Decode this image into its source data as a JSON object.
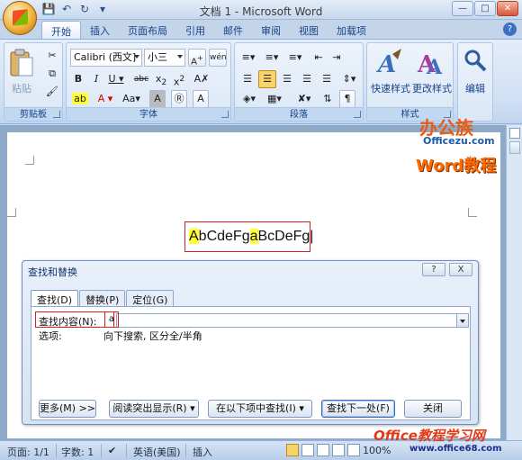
{
  "window": {
    "title": "文档 1 - Microsoft Word",
    "controls": [
      "minimize",
      "maximize",
      "close"
    ]
  },
  "ribbon_tabs": [
    "开始",
    "插入",
    "页面布局",
    "引用",
    "邮件",
    "审阅",
    "视图",
    "加载项"
  ],
  "ribbon": {
    "clipboard": {
      "label": "剪贴板",
      "paste": "粘贴"
    },
    "font": {
      "label": "字体",
      "font_name": "Calibri (西文]",
      "font_size": "小三",
      "wen": "wén"
    },
    "paragraph": {
      "label": "段落"
    },
    "styles": {
      "label": "样式",
      "quick_styles": "快速样式",
      "change_styles": "更改样式"
    },
    "editing": {
      "label": "编辑"
    }
  },
  "document": {
    "sample_text": "AbCdeFgaBcDeFg",
    "highlighted_chars": [
      "A",
      "a"
    ]
  },
  "dialog": {
    "title": "查找和替换",
    "tabs": [
      "查找(D)",
      "替换(P)",
      "定位(G)"
    ],
    "find_label": "查找内容(N):",
    "find_value": "a",
    "options_label": "选项:",
    "options_value": "向下搜索, 区分全/半角",
    "buttons": {
      "more": "更多(M) >>",
      "reading_highlight": "阅读突出显示(R)",
      "find_in": "在以下项中查找(I)",
      "find_next": "查找下一处(F)",
      "close": "关闭"
    },
    "title_buttons": [
      "?",
      "X"
    ]
  },
  "statusbar": {
    "page": "页面: 1/1",
    "words": "字数: 1",
    "language": "英语(美国)",
    "insert_mode": "插入",
    "zoom": "100%"
  },
  "watermark": {
    "line1": "办公族",
    "line2": "Officezu.com",
    "line3": "Word教程",
    "footer1": "Office教程学习网",
    "footer2": "www.office68.com"
  }
}
